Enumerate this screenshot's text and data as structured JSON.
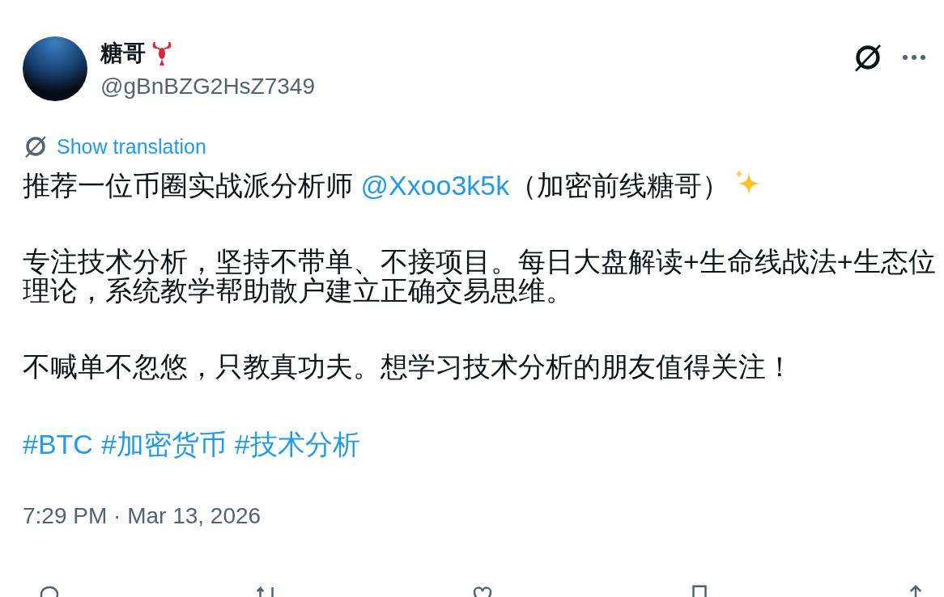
{
  "author": {
    "name": "糖哥",
    "handle": "@gBnBZG2HsZ7349"
  },
  "translate_link": "Show translation",
  "body": [
    {
      "kind": "intro",
      "text": "推荐一位币圈实战派分析师 ",
      "mention": "@Xxoo3k5k",
      "after": "（加密前线糖哥）"
    },
    {
      "kind": "text",
      "text": "专注技术分析，坚持不带单、不接项目。每日大盘解读+生命线战法+生态位理论，系统教学帮助散户建立正确交易思维。"
    },
    {
      "kind": "text",
      "text": "不喊单不忽悠，只教真功夫。想学习技术分析的朋友值得关注！"
    },
    {
      "kind": "tags",
      "tags": [
        "#BTC",
        "#加密货币",
        "#技术分析"
      ]
    }
  ],
  "timestamp": "7:29 PM · Mar 13, 2026"
}
